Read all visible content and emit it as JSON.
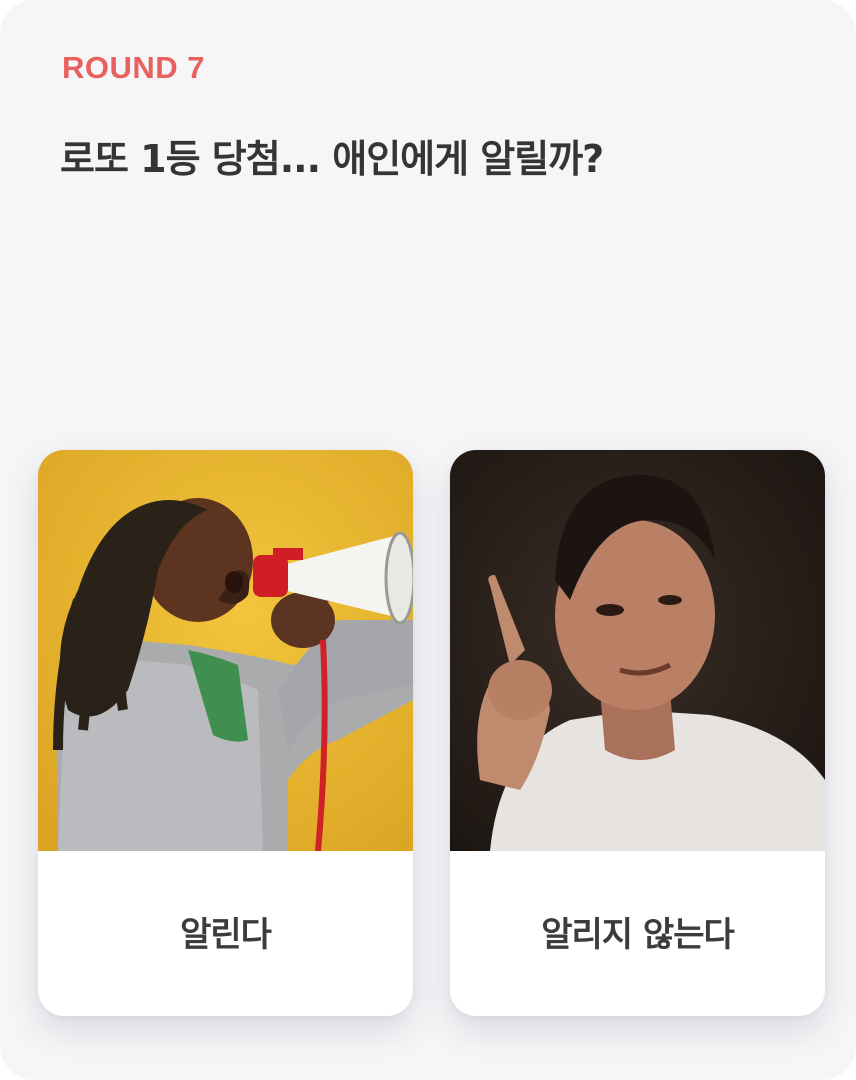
{
  "round_label": "ROUND 7",
  "question": "로또 1등 당첨... 애인에게 알릴까?",
  "options": [
    {
      "label": "알린다",
      "image": "man-shouting-into-megaphone-photo"
    },
    {
      "label": "알리지 않는다",
      "image": "woman-wagging-finger-photo"
    }
  ],
  "colors": {
    "accent": "#e8615f",
    "background": "#f6f6f7",
    "text": "#353535"
  }
}
